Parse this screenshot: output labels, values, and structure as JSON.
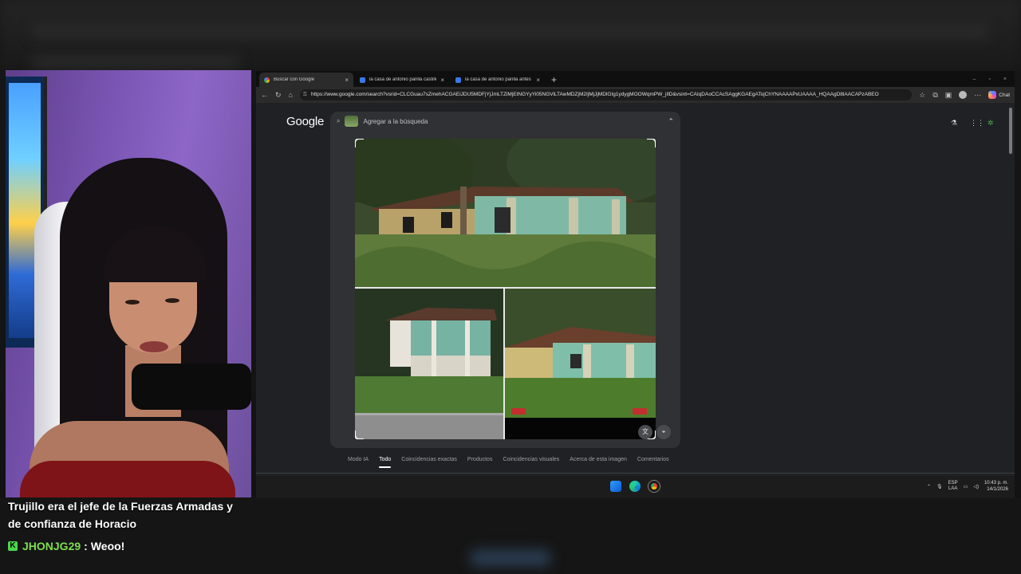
{
  "chat": {
    "message": "Trujillo era el jefe de la Fuerzas Armadas y de confianza de Horacio",
    "username": "JHONJG29",
    "separator": ":",
    "user_message": "Weoo!"
  },
  "browser": {
    "tabs": [
      {
        "title": "Buscar con Google",
        "favicon": "google-icon",
        "active": true
      },
      {
        "title": "la casa de antonio parilla castillo",
        "favicon": "bing-icon",
        "active": false
      },
      {
        "title": "la casa de antonio parilla antes de",
        "favicon": "bing-icon",
        "active": false
      }
    ],
    "tab_close": "×",
    "new_tab": "+",
    "window_buttons": [
      "–",
      "▫",
      "×"
    ],
    "url": "https://www.google.com/search?vsrid=CLCGuau7sZmehACGAEiJDU5MDFjYjJmLTZiMjEtNGYyYi05NGViLTAwMDZjM2IjMjJjMDlGIg1ydygMOOWqmPW_jIlD&vsint=CAIqDAoCCAcSAggKGAEgATojChYNAAAAPxUAAAA_HQAAgD8lAACAPzABEO",
    "chat_label": "Chat"
  },
  "google": {
    "logo_text": "Google",
    "search_placeholder": "Agregar a la búsqueda",
    "result_tabs": [
      "Modo IA",
      "Todo",
      "Coincidencias exactas",
      "Productos",
      "Coincidencias visuales",
      "Acerca de esta imagen",
      "Comentarios"
    ],
    "active_tab": "Todo",
    "image_subject": "old abandoned house with teal walls in overgrown grass"
  },
  "taskbar": {
    "lang_top": "ESP",
    "lang_bottom": "LAA",
    "time": "10:43 p. m.",
    "date": "14/1/2026"
  }
}
